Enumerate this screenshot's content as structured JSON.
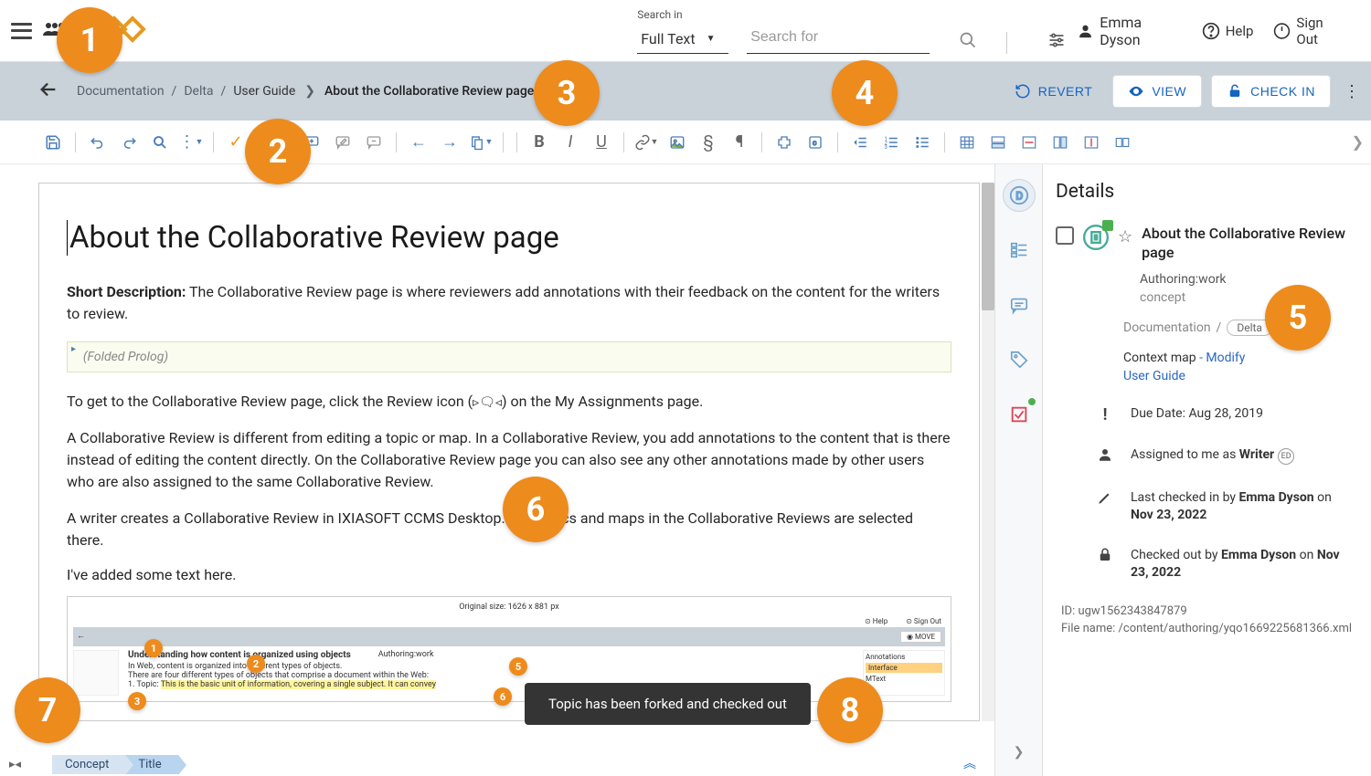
{
  "header": {
    "search_in_label": "Search in",
    "search_in_value": "Full Text",
    "search_for_placeholder": "Search for",
    "user_name": "Emma Dyson",
    "help_label": "Help",
    "signout_label": "Sign Out"
  },
  "breadcrumb": {
    "seg1": "Documentation",
    "seg2": "Delta",
    "seg3": "User Guide",
    "seg4": "About the Collaborative Review page"
  },
  "actions": {
    "revert": "REVERT",
    "view": "VIEW",
    "checkin": "CHECK IN"
  },
  "document": {
    "title": "About the Collaborative Review page",
    "short_desc_label": "Short Description:",
    "short_desc_text": " The Collaborative Review page is where reviewers add annotations with their feedback on the content for the writers to review.",
    "folded_prolog": "(Folded Prolog)",
    "para1_a": "To get to the Collaborative Review page, click the Review icon (",
    "para1_b": ") on the My Assignments page.",
    "para2": "A Collaborative Review is different from editing a topic or map. In a Collaborative Review, you add annotations to the content that is there instead of editing the content directly. On the Collaborative Review page you can also see any other annotations made by other users who are also assigned to the same Collaborative Review.",
    "para3": "A writer creates a Collaborative Review in IXIASOFT CCMS Desktop. The topics and maps in the Collaborative Reviews are selected there.",
    "para4": "I've added some text here.",
    "embedded": {
      "size_label": "Original size: 1626 x 881 px",
      "title": "Understanding how content is organized using objects",
      "status": "Authoring:work",
      "line1": "In Web, content is organized into different types of objects.",
      "line2": "There are four different types of objects that comprise a document within the Web:",
      "line3a": "1. Topic: ",
      "line3b": "This is the basic unit of information, covering a single subject. It can convey",
      "ann_header": "Annotations",
      "ann1": "Interface",
      "ann2": "MText",
      "move": "MOVE"
    }
  },
  "bottom_breadcrumb": {
    "item1": "Concept",
    "item2": "Title"
  },
  "details": {
    "panel_title": "Details",
    "doc_title": "About the Collaborative Review page",
    "authoring": "Authoring:work",
    "concept": "concept",
    "path_seg1": "Documentation",
    "path_delta": "Delta",
    "context_map_label": "Context map  ",
    "modify": "- Modify",
    "user_guide": "User Guide",
    "due_date": "Due Date: Aug 28, 2019",
    "assigned_prefix": "Assigned to me as ",
    "assigned_role": "Writer",
    "checkin_prefix": "Last checked in by ",
    "checkin_name": "Emma Dyson",
    "checkin_on": " on",
    "checkin_date": "Nov 23, 2022",
    "checkout_prefix": "Checked out by ",
    "checkout_name": "Emma Dyson",
    "checkout_on": " on ",
    "checkout_date": "Nov 23, 2022",
    "id": "ID: ugw1562343847879",
    "filename": "File name: /content/authoring/yqo1669225681366.xml"
  },
  "toast": {
    "message": "Topic has been forked and checked out"
  },
  "callouts": {
    "c1": "1",
    "c2": "2",
    "c3": "3",
    "c4": "4",
    "c5": "5",
    "c6": "6",
    "c7": "7",
    "c8": "8",
    "s1": "1",
    "s2": "2",
    "s3": "3",
    "s5": "5",
    "s6": "6"
  }
}
